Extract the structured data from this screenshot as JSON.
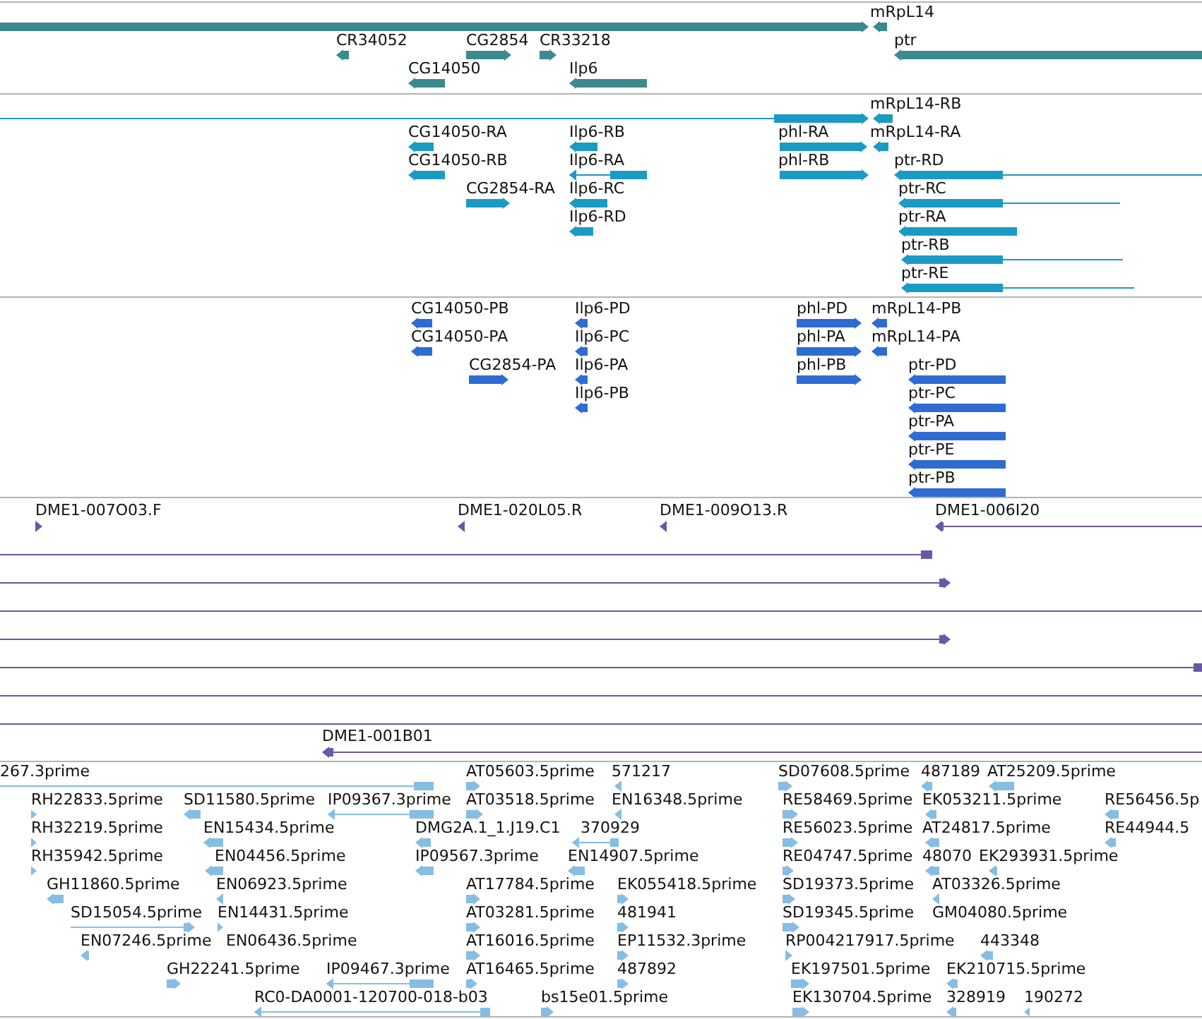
{
  "tracks": [
    {
      "features": [
        {
          "reverse": false
        },
        {
          "label": "mRpL14",
          "reverse": true
        },
        {
          "label": "CR34052",
          "reverse": true
        },
        {
          "label": "CG2854",
          "reverse": false
        },
        {
          "label": "CR33218",
          "reverse": false
        },
        {
          "label": "ptr",
          "reverse": true
        },
        {
          "label": "CG14050",
          "reverse": true
        },
        {
          "label": "Ilp6",
          "reverse": true
        }
      ]
    },
    {
      "features": [
        {
          "reverse": false
        },
        {
          "label": "mRpL14-RB",
          "reverse": true
        },
        {
          "label": "CG14050-RA",
          "reverse": true
        },
        {
          "label": "Ilp6-RB",
          "reverse": true
        },
        {
          "label": "phl-RA",
          "reverse": false
        },
        {
          "label": "mRpL14-RA",
          "reverse": true
        },
        {
          "label": "CG14050-RB",
          "reverse": true
        },
        {
          "label": "Ilp6-RA",
          "reverse": true
        },
        {
          "label": "phl-RB",
          "reverse": false
        },
        {
          "label": "ptr-RD",
          "reverse": true
        },
        {
          "label": "CG2854-RA",
          "reverse": false
        },
        {
          "label": "Ilp6-RC",
          "reverse": true
        },
        {
          "label": "ptr-RC",
          "reverse": true
        },
        {
          "label": "Ilp6-RD",
          "reverse": true
        },
        {
          "label": "ptr-RA",
          "reverse": true
        },
        {
          "label": "ptr-RB",
          "reverse": true
        },
        {
          "label": "ptr-RE",
          "reverse": true
        }
      ]
    },
    {
      "features": [
        {
          "label": "CG14050-PB",
          "reverse": true
        },
        {
          "label": "Ilp6-PD",
          "reverse": true
        },
        {
          "label": "phl-PD",
          "reverse": false
        },
        {
          "label": "mRpL14-PB",
          "reverse": true
        },
        {
          "label": "CG14050-PA",
          "reverse": true
        },
        {
          "label": "Ilp6-PC",
          "reverse": true
        },
        {
          "label": "phl-PA",
          "reverse": false
        },
        {
          "label": "mRpL14-PA",
          "reverse": true
        },
        {
          "label": "CG2854-PA",
          "reverse": false
        },
        {
          "label": "Ilp6-PA",
          "reverse": true
        },
        {
          "label": "phl-PB",
          "reverse": false
        },
        {
          "label": "ptr-PD",
          "reverse": true
        },
        {
          "label": "Ilp6-PB",
          "reverse": true
        },
        {
          "label": "ptr-PC",
          "reverse": true
        },
        {
          "label": "ptr-PA",
          "reverse": true
        },
        {
          "label": "ptr-PE",
          "reverse": true
        },
        {
          "label": "ptr-PB",
          "reverse": true
        }
      ]
    },
    {
      "features": [
        {
          "label": "DME1-007O03.F",
          "kind": "arrow",
          "reverse": false
        },
        {
          "label": "DME1-020L05.R",
          "kind": "arrow",
          "reverse": true
        },
        {
          "label": "DME1-009O13.R",
          "kind": "arrow",
          "reverse": true
        },
        {
          "label": "DME1-006I20",
          "kind": "arrow",
          "reverse": true
        },
        {
          "kind": "arrow",
          "reverse": true
        },
        {
          "kind": "arrow",
          "reverse": false
        },
        {
          "kind": "line"
        },
        {
          "kind": "arrow",
          "reverse": false
        },
        {
          "kind": "line"
        },
        {
          "kind": "line"
        },
        {
          "kind": "line"
        },
        {
          "label": "DME1-001B01",
          "kind": "arrow",
          "reverse": true
        }
      ]
    },
    {
      "features": [
        {
          "label": "267.3prime",
          "reverse": true
        },
        {
          "label": "AT05603.5prime",
          "reverse": false
        },
        {
          "label": "571217",
          "reverse": true
        },
        {
          "label": "SD07608.5prime",
          "reverse": false
        },
        {
          "label": "487189",
          "reverse": true
        },
        {
          "label": "AT25209.5prime",
          "reverse": true
        },
        {
          "label": "RH22833.5prime",
          "reverse": false
        },
        {
          "label": "SD11580.5prime",
          "reverse": true
        },
        {
          "label": "IP09367.3prime",
          "reverse": true
        },
        {
          "label": "AT03518.5prime",
          "reverse": false
        },
        {
          "label": "EN16348.5prime",
          "reverse": true
        },
        {
          "label": "RE58469.5prime",
          "reverse": false
        },
        {
          "label": "EK053211.5prime",
          "reverse": true
        },
        {
          "label": "RE56456.5p",
          "reverse": true
        },
        {
          "label": "RH32219.5prime",
          "reverse": false
        },
        {
          "label": "EN15434.5prime",
          "reverse": true
        },
        {
          "label": "DMG2A.1_1.J19.C1",
          "reverse": true
        },
        {
          "label": "370929",
          "reverse": true
        },
        {
          "label": "RE56023.5prime",
          "reverse": false
        },
        {
          "label": "AT24817.5prime",
          "reverse": true
        },
        {
          "label": "RE44944.5",
          "reverse": true
        },
        {
          "label": "RH35942.5prime",
          "reverse": false
        },
        {
          "label": "EN04456.5prime",
          "reverse": true
        },
        {
          "label": "IP09567.3prime",
          "reverse": true
        },
        {
          "label": "EN14907.5prime",
          "reverse": true
        },
        {
          "label": "RE04747.5prime",
          "reverse": false
        },
        {
          "label": "48070",
          "reverse": true
        },
        {
          "label": "EK293931.5prime",
          "reverse": true
        },
        {
          "label": "GH11860.5prime",
          "reverse": true
        },
        {
          "label": "EN06923.5prime",
          "reverse": true
        },
        {
          "label": "AT17784.5prime",
          "reverse": false
        },
        {
          "label": "EK055418.5prime",
          "reverse": false
        },
        {
          "label": "SD19373.5prime",
          "reverse": false
        },
        {
          "label": "AT03326.5prime",
          "reverse": true
        },
        {
          "label": "SD15054.5prime",
          "reverse": false
        },
        {
          "label": "EN14431.5prime",
          "reverse": false
        },
        {
          "label": "AT03281.5prime",
          "reverse": false
        },
        {
          "label": "481941",
          "reverse": false
        },
        {
          "label": "SD19345.5prime",
          "reverse": false
        },
        {
          "label": "GM04080.5prime"
        },
        {
          "label": "EN07246.5prime",
          "reverse": true
        },
        {
          "label": "EN06436.5prime"
        },
        {
          "label": "AT16016.5prime",
          "reverse": false
        },
        {
          "label": "EP11532.3prime",
          "reverse": false
        },
        {
          "label": "RP004217917.5prime",
          "reverse": false
        },
        {
          "label": "443348",
          "reverse": true
        },
        {
          "label": "GH22241.5prime",
          "reverse": false
        },
        {
          "label": "IP09467.3prime",
          "reverse": true
        },
        {
          "label": "AT16465.5prime",
          "reverse": false
        },
        {
          "label": "487892",
          "reverse": false
        },
        {
          "label": "EK197501.5prime",
          "reverse": false
        },
        {
          "label": "EK210715.5prime",
          "reverse": true
        },
        {
          "label": "RC0-DA0001-120700-018-b03",
          "reverse": true
        },
        {
          "label": "bs15e01.5prime",
          "reverse": false
        },
        {
          "label": "EK130704.5prime",
          "reverse": false
        },
        {
          "label": "328919",
          "reverse": true
        },
        {
          "label": "190272",
          "reverse": true
        }
      ]
    }
  ]
}
